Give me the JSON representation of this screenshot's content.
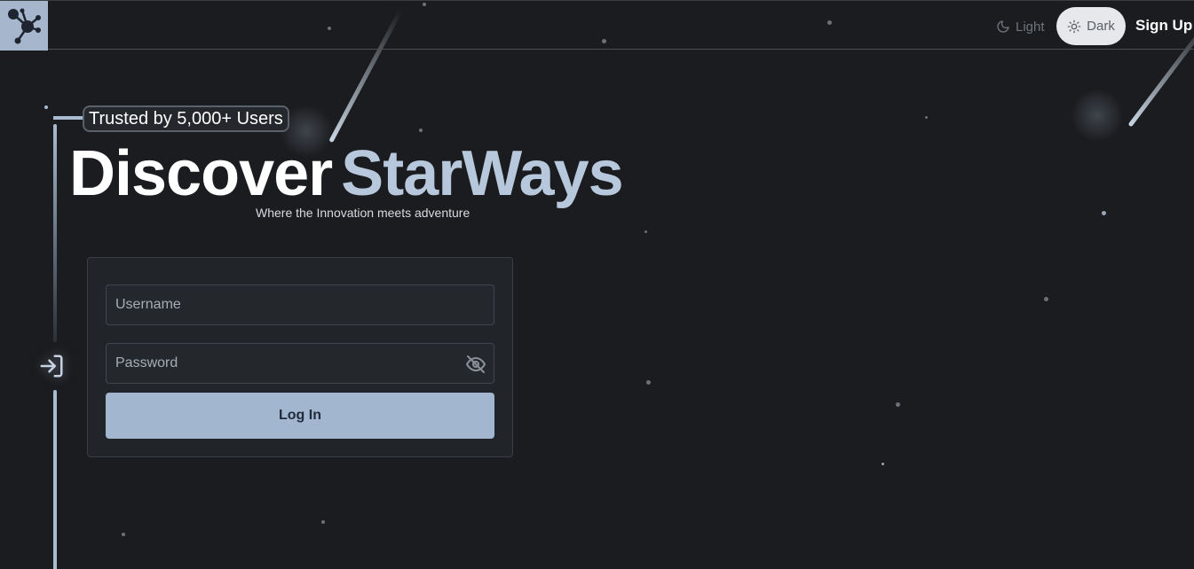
{
  "header": {
    "theme_light_label": "Light",
    "theme_dark_label": "Dark",
    "signup_label": "Sign Up"
  },
  "hero": {
    "badge": "Trusted by 5,000+ Users",
    "title_part1": "Discover",
    "title_part2": "StarWays",
    "subtitle": "Where the Innovation meets adventure"
  },
  "form": {
    "username_placeholder": "Username",
    "password_placeholder": "Password",
    "login_label": "Log In"
  },
  "colors": {
    "background": "#1b1c1f",
    "accent": "#a3b6d0",
    "title_accent": "#b8c8dc"
  }
}
